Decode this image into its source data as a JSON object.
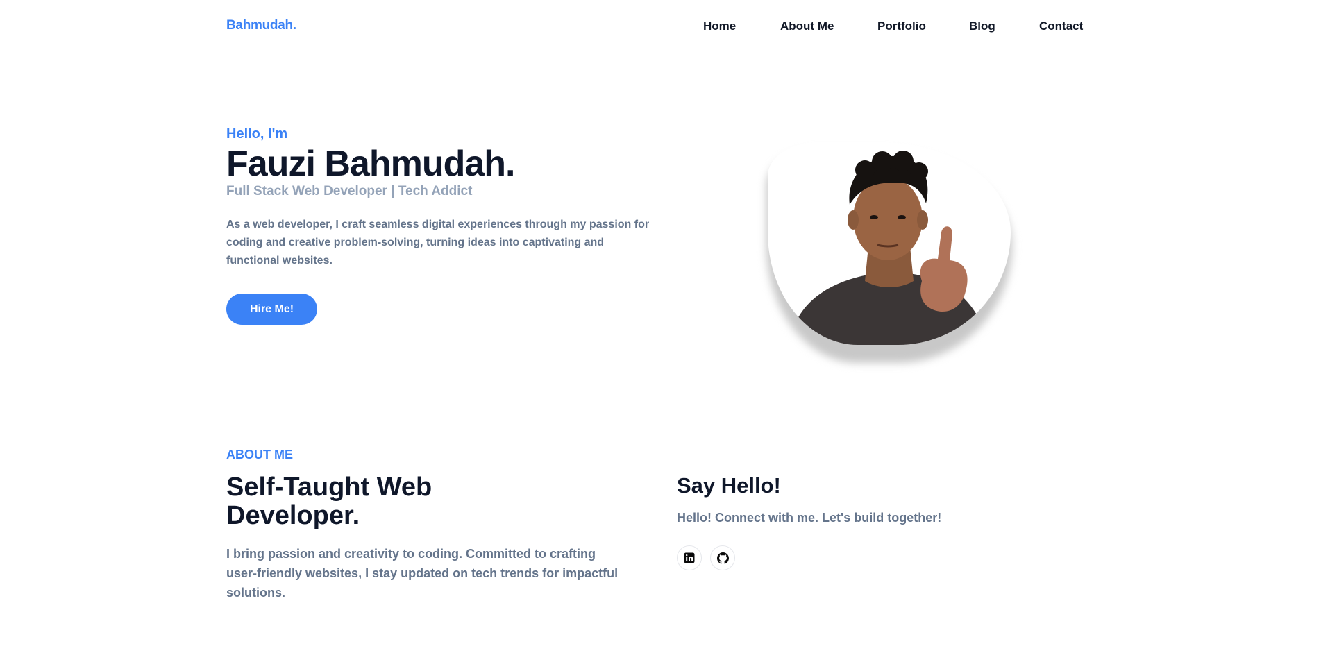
{
  "nav": {
    "logo": "Bahmudah.",
    "items": [
      "Home",
      "About Me",
      "Portfolio",
      "Blog",
      "Contact"
    ]
  },
  "hero": {
    "greeting": "Hello, I'm",
    "name": "Fauzi Bahmudah.",
    "role": "Full Stack Web Developer | Tech Addict",
    "description": "As a web developer, I craft seamless digital experiences through my passion for coding and creative problem-solving, turning ideas into captivating and functional websites.",
    "cta": "Hire Me!"
  },
  "about": {
    "label": "ABOUT ME",
    "title": "Self-Taught Web Developer.",
    "description": "I bring passion and creativity to coding. Committed to crafting user-friendly websites, I stay updated on tech trends for impactful solutions."
  },
  "contact": {
    "title": "Say Hello!",
    "description": "Hello! Connect with me. Let's build together!",
    "social_icons": [
      "linkedin-icon",
      "github-icon"
    ]
  },
  "colors": {
    "accent": "#3b82f6",
    "heading": "#0f172a",
    "muted": "#64748b",
    "subtle": "#94a3b8"
  }
}
